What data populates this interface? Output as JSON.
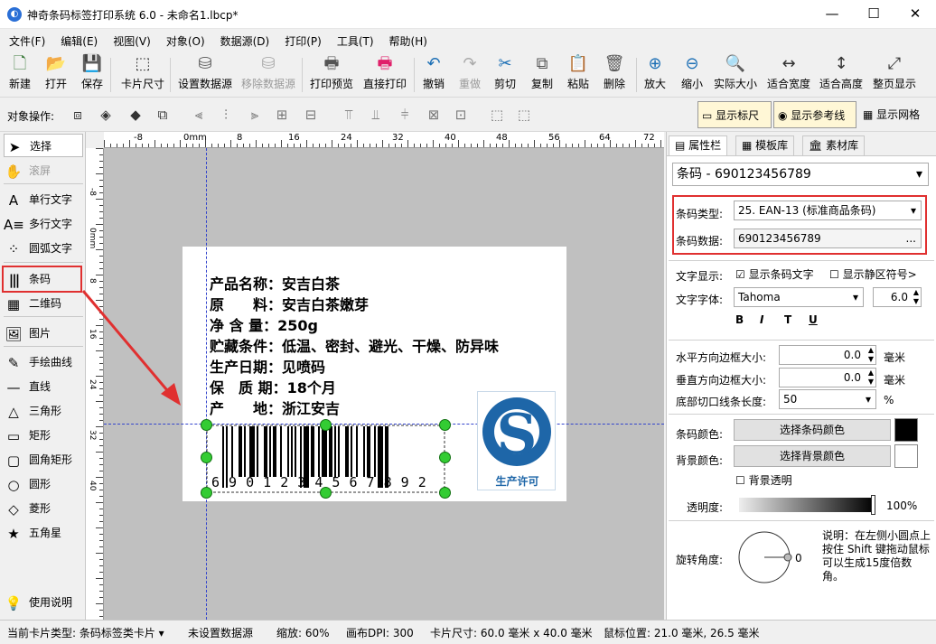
{
  "window": {
    "title": "神奇条码标签打印系统 6.0 - 未命名1.lbcp*",
    "app_icon": "app-logo-icon",
    "minimize": "—",
    "maximize": "☐",
    "close": "✕"
  },
  "menu": [
    "文件(F)",
    "编辑(E)",
    "视图(V)",
    "对象(O)",
    "数据源(D)",
    "打印(P)",
    "工具(T)",
    "帮助(H)"
  ],
  "toolbar": [
    {
      "label": "新建",
      "icon": "new-file-icon",
      "glyph": "🗋",
      "color": "#3b7a3b",
      "enabled": true
    },
    {
      "label": "打开",
      "icon": "open-icon",
      "glyph": "📂",
      "color": "#1c6fb5",
      "enabled": true
    },
    {
      "label": "保存",
      "icon": "save-icon",
      "glyph": "💾",
      "color": "#7a2a8a",
      "enabled": true
    },
    {
      "label": "卡片尺寸",
      "icon": "card-size-icon",
      "glyph": "⬚",
      "color": "#333",
      "enabled": true
    },
    {
      "label": "设置数据源",
      "icon": "set-datasource-icon",
      "glyph": "⛁",
      "color": "#555",
      "enabled": true
    },
    {
      "label": "移除数据源",
      "icon": "remove-datasource-icon",
      "glyph": "⛁",
      "color": "#aaa",
      "enabled": false
    },
    {
      "label": "打印预览",
      "icon": "print-preview-icon",
      "glyph": "🖶",
      "color": "#555",
      "enabled": true
    },
    {
      "label": "直接打印",
      "icon": "direct-print-icon",
      "glyph": "🖶",
      "color": "#e0206a",
      "enabled": true
    },
    {
      "label": "撤销",
      "icon": "undo-icon",
      "glyph": "↶",
      "color": "#1c6fb5",
      "enabled": true
    },
    {
      "label": "重做",
      "icon": "redo-icon",
      "glyph": "↷",
      "color": "#aaa",
      "enabled": false
    },
    {
      "label": "剪切",
      "icon": "cut-icon",
      "glyph": "✂",
      "color": "#1c6fb5",
      "enabled": true
    },
    {
      "label": "复制",
      "icon": "copy-icon",
      "glyph": "⧉",
      "color": "#555",
      "enabled": true
    },
    {
      "label": "粘贴",
      "icon": "paste-icon",
      "glyph": "📋",
      "color": "#b07a2a",
      "enabled": true
    },
    {
      "label": "删除",
      "icon": "delete-icon",
      "glyph": "🗑",
      "color": "#555",
      "enabled": true
    },
    {
      "label": "放大",
      "icon": "zoom-in-icon",
      "glyph": "⊕",
      "color": "#1c6fb5",
      "enabled": true
    },
    {
      "label": "缩小",
      "icon": "zoom-out-icon",
      "glyph": "⊖",
      "color": "#1c6fb5",
      "enabled": true
    },
    {
      "label": "实际大小",
      "icon": "actual-size-icon",
      "glyph": "🔍",
      "color": "#1c6fb5",
      "enabled": true
    },
    {
      "label": "适合宽度",
      "icon": "fit-width-icon",
      "glyph": "↔",
      "color": "#333",
      "enabled": true
    },
    {
      "label": "适合高度",
      "icon": "fit-height-icon",
      "glyph": "↕",
      "color": "#333",
      "enabled": true
    },
    {
      "label": "整页显示",
      "icon": "fit-page-icon",
      "glyph": "⤢",
      "color": "#333",
      "enabled": true
    }
  ],
  "object_bar": {
    "label": "对象操作:",
    "show_ruler": "显示标尺",
    "show_guides": "显示参考线",
    "show_grid": "显示网格"
  },
  "left_tools": [
    {
      "label": "选择",
      "icon": "pointer-icon",
      "glyph": "➤",
      "selected": true,
      "enabled": true
    },
    {
      "label": "滚屏",
      "icon": "hand-icon",
      "glyph": "✋",
      "selected": false,
      "enabled": false
    },
    {
      "label": "单行文字",
      "icon": "single-line-text-icon",
      "glyph": "A",
      "selected": false,
      "enabled": true
    },
    {
      "label": "多行文字",
      "icon": "multi-line-text-icon",
      "glyph": "A≡",
      "selected": false,
      "enabled": true
    },
    {
      "label": "圆弧文字",
      "icon": "arc-text-icon",
      "glyph": "⁘",
      "selected": false,
      "enabled": true
    },
    {
      "label": "条码",
      "icon": "barcode-icon",
      "glyph": "|||",
      "selected": false,
      "enabled": true
    },
    {
      "label": "二维码",
      "icon": "qrcode-icon",
      "glyph": "▦",
      "selected": false,
      "enabled": true
    },
    {
      "label": "图片",
      "icon": "image-icon",
      "glyph": "🖼",
      "selected": false,
      "enabled": true
    },
    {
      "label": "手绘曲线",
      "icon": "pen-icon",
      "glyph": "✎",
      "selected": false,
      "enabled": true
    },
    {
      "label": "直线",
      "icon": "line-icon",
      "glyph": "—",
      "selected": false,
      "enabled": true
    },
    {
      "label": "三角形",
      "icon": "triangle-icon",
      "glyph": "△",
      "selected": false,
      "enabled": true
    },
    {
      "label": "矩形",
      "icon": "rectangle-icon",
      "glyph": "▭",
      "selected": false,
      "enabled": true
    },
    {
      "label": "圆角矩形",
      "icon": "rounded-rectangle-icon",
      "glyph": "▢",
      "selected": false,
      "enabled": true
    },
    {
      "label": "圆形",
      "icon": "circle-icon",
      "glyph": "○",
      "selected": false,
      "enabled": true
    },
    {
      "label": "菱形",
      "icon": "diamond-icon",
      "glyph": "◇",
      "selected": false,
      "enabled": true
    },
    {
      "label": "五角星",
      "icon": "star-icon",
      "glyph": "★",
      "selected": false,
      "enabled": true
    }
  ],
  "help": {
    "label": "使用说明",
    "icon": "lightbulb-icon",
    "glyph": "💡"
  },
  "ruler": {
    "h_ticks": [
      "-8",
      "0mm",
      "8",
      "16",
      "24",
      "32",
      "40",
      "48",
      "56",
      "64",
      "72"
    ],
    "v_ticks": [
      "-8",
      "0mm",
      "8",
      "16",
      "24",
      "32",
      "40"
    ]
  },
  "label": {
    "lines": [
      "产品名称：安吉白茶",
      "原　　料：安吉白茶嫩芽",
      "净 含 量：250g",
      "贮藏条件：低温、密封、避光、干燥、防异味",
      "生产日期：见喷码",
      "保　质 期：18个月",
      "产　　地：浙江安吉"
    ],
    "barcode_digits": "6 9 0 1 2 3 4 5 6 7 8 9 2",
    "logo_text": "生产许可",
    "logo_color": "#1e66a8"
  },
  "right_panel": {
    "tabs": [
      {
        "label": "属性栏",
        "icon": "properties-icon"
      },
      {
        "label": "模板库",
        "icon": "template-icon"
      },
      {
        "label": "素材库",
        "icon": "library-icon"
      }
    ],
    "object_select": "条码 - 690123456789",
    "barcode_type_label": "条码类型:",
    "barcode_type": "25. EAN-13 (标准商品条码)",
    "barcode_data_label": "条码数据:",
    "barcode_data": "690123456789",
    "ellipsis": "...",
    "text_display_label": "文字显示:",
    "show_text": "显示条码文字",
    "show_text_checked": true,
    "show_quiet": "显示静区符号>",
    "show_quiet_checked": false,
    "font_label": "文字字体:",
    "font": "Tahoma",
    "font_size": "6.0",
    "format_buttons": [
      "B",
      "I",
      "T",
      "U"
    ],
    "h_margin_label": "水平方向边框大小:",
    "h_margin": "0.0",
    "v_margin_label": "垂直方向边框大小:",
    "v_margin": "0.0",
    "unit_mm": "毫米",
    "cut_label": "底部切口线条长度:",
    "cut": "50",
    "percent": "%",
    "bar_color_label": "条码颜色:",
    "bar_color_btn": "选择条码颜色",
    "bar_color": "#000000",
    "bg_color_label": "背景颜色:",
    "bg_color_btn": "选择背景颜色",
    "bg_color": "#ffffff",
    "bg_transparent": "背景透明",
    "opacity_label": "透明度:",
    "opacity": "100%",
    "rotation_label": "旋转角度:",
    "rotation": "0",
    "rotation_note": "说明：在左侧小圆点上按住 Shift 键拖动鼠标可以生成15度倍数角。"
  },
  "status": {
    "card_type": "当前卡片类型: 条码标签类卡片 ▾",
    "datasource": "未设置数据源",
    "zoom": "缩放: 60%",
    "dpi": "画布DPI: 300",
    "card_size": "卡片尺寸: 60.0 毫米 x 40.0 毫米",
    "mouse": "鼠标位置: 21.0 毫米, 26.5 毫米"
  },
  "highlight_color": "#e03030"
}
